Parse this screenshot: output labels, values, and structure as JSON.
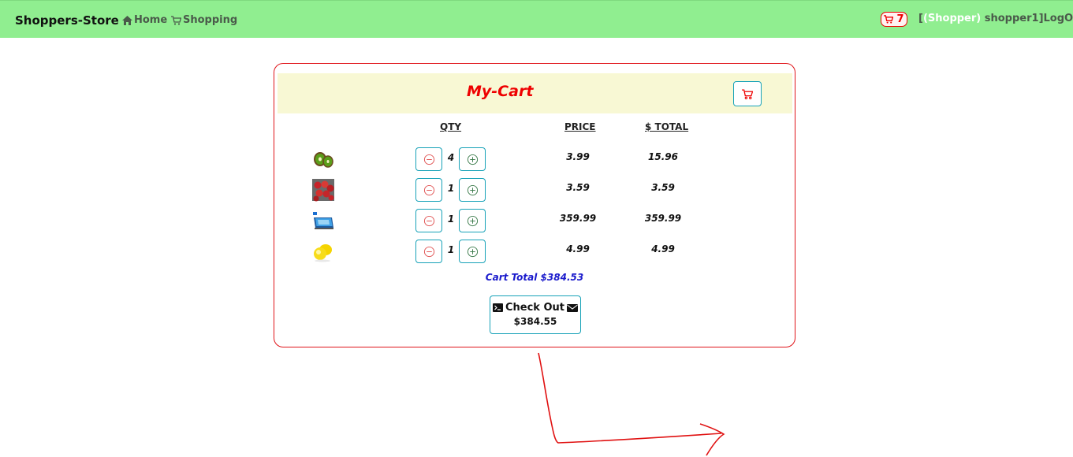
{
  "navbar": {
    "brand": "Shoppers-Store",
    "links": [
      {
        "label": "Home",
        "icon": "home-icon"
      },
      {
        "label": "Shopping",
        "icon": "cart-icon"
      }
    ],
    "cart_count": "7",
    "user_open": "[",
    "user_role": "(Shopper)",
    "user_name": " shopper1]",
    "logout": "LogOut"
  },
  "cart": {
    "title": "My-Cart",
    "columns": {
      "qty": "QTY",
      "price": "PRICE",
      "total": "$ TOTAL"
    },
    "items": [
      {
        "image": "kiwi",
        "qty": "4",
        "price": "3.99",
        "total": "15.96"
      },
      {
        "image": "tomatoes",
        "qty": "1",
        "price": "3.59",
        "total": "3.59"
      },
      {
        "image": "tablet",
        "qty": "1",
        "price": "359.99",
        "total": "359.99"
      },
      {
        "image": "lemon",
        "qty": "1",
        "price": "4.99",
        "total": "4.99"
      }
    ],
    "cart_total": "Cart Total $384.53",
    "checkout": {
      "label": "Check Out",
      "amount": "$384.55"
    }
  },
  "colors": {
    "navbar": "#90ee90",
    "accent": "#e00000",
    "button_border": "#17a2b8",
    "total_text": "#1a1acc",
    "header_bg": "#f8f8d4"
  }
}
